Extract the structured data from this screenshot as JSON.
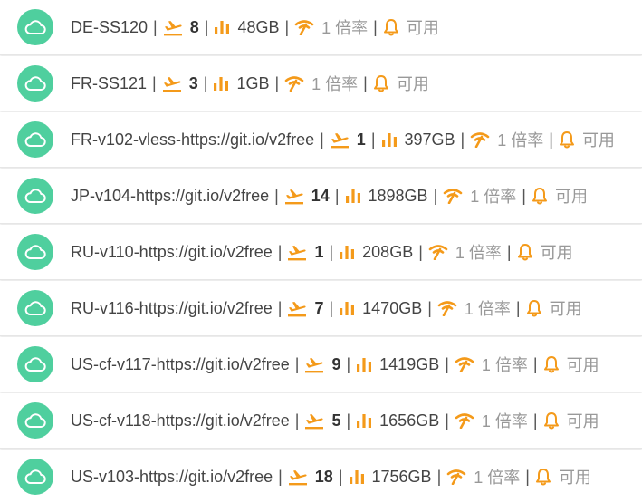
{
  "colors": {
    "avatar": "#4fcf9e",
    "accent": "#f49a1a",
    "text": "#444444",
    "muted": "#999999"
  },
  "icons": {
    "avatar": "cloud-icon",
    "count": "airplane-takeoff-icon",
    "traffic": "bar-chart-icon",
    "rate": "signal-icon",
    "status": "bell-icon"
  },
  "servers": [
    {
      "name": "DE-SS120",
      "count": "8",
      "traffic": "48GB",
      "rate": "1 倍率",
      "status": "可用"
    },
    {
      "name": "FR-SS121",
      "count": "3",
      "traffic": "1GB",
      "rate": "1 倍率",
      "status": "可用"
    },
    {
      "name": "FR-v102-vless-https://git.io/v2free",
      "count": "1",
      "traffic": "397GB",
      "rate": "1 倍率",
      "status": "可用"
    },
    {
      "name": "JP-v104-https://git.io/v2free",
      "count": "14",
      "traffic": "1898GB",
      "rate": "1 倍率",
      "status": "可用"
    },
    {
      "name": "RU-v110-https://git.io/v2free",
      "count": "1",
      "traffic": "208GB",
      "rate": "1 倍率",
      "status": "可用"
    },
    {
      "name": "RU-v116-https://git.io/v2free",
      "count": "7",
      "traffic": "1470GB",
      "rate": "1 倍率",
      "status": "可用"
    },
    {
      "name": "US-cf-v117-https://git.io/v2free",
      "count": "9",
      "traffic": "1419GB",
      "rate": "1 倍率",
      "status": "可用"
    },
    {
      "name": "US-cf-v118-https://git.io/v2free",
      "count": "5",
      "traffic": "1656GB",
      "rate": "1 倍率",
      "status": "可用"
    },
    {
      "name": "US-v103-https://git.io/v2free",
      "count": "18",
      "traffic": "1756GB",
      "rate": "1 倍率",
      "status": "可用"
    }
  ]
}
